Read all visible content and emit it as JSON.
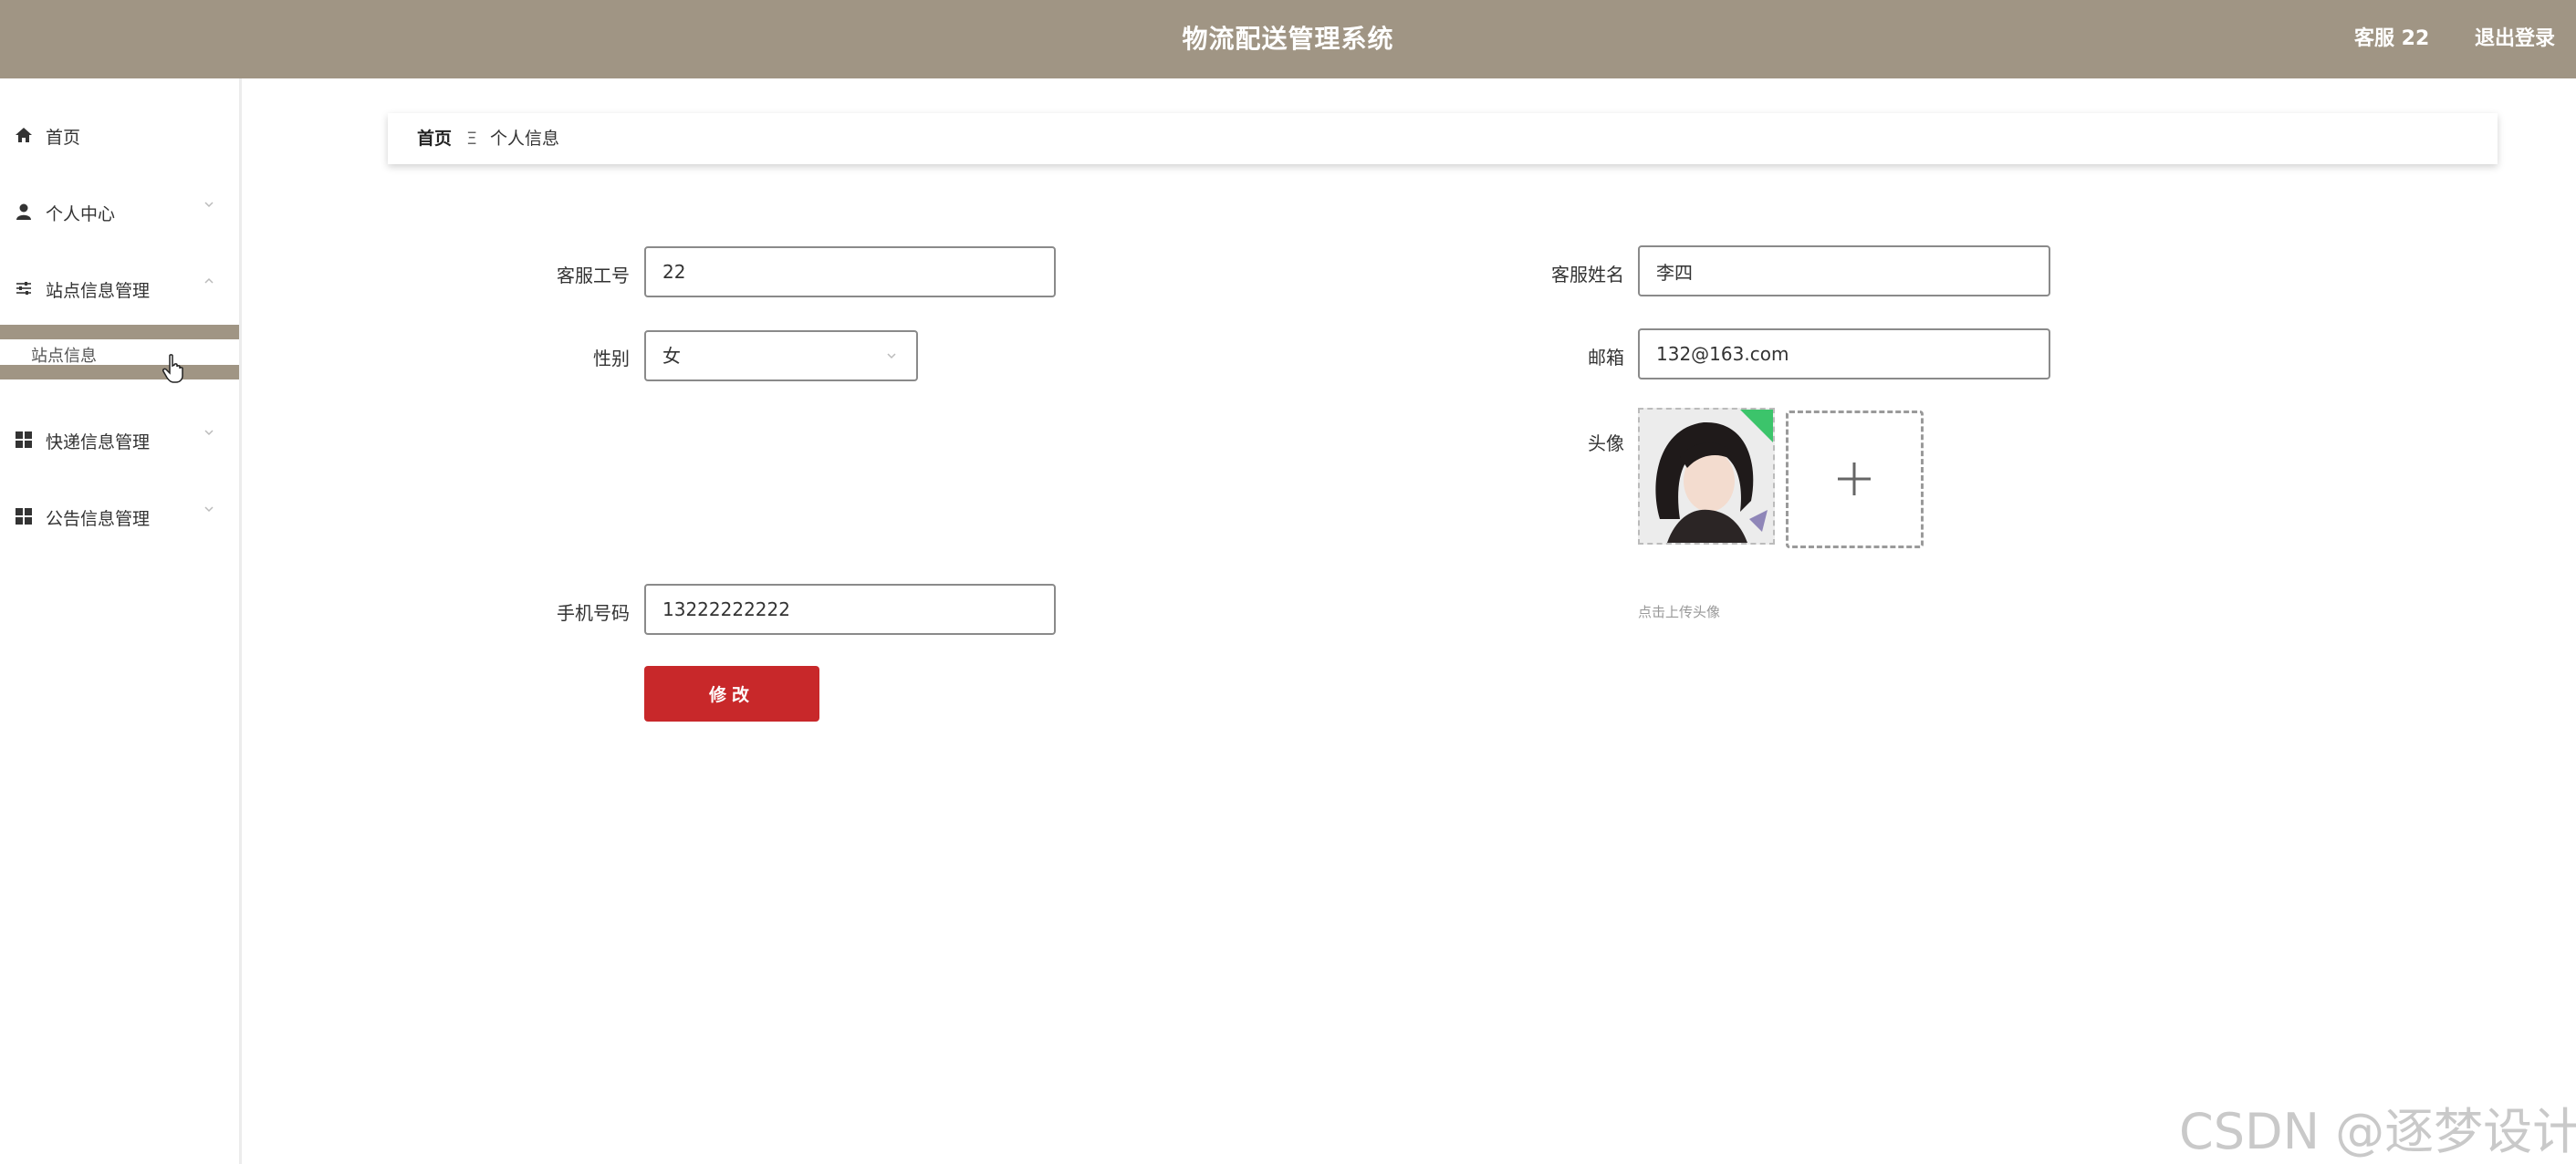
{
  "header": {
    "title": "物流配送管理系统",
    "user": "客服 22",
    "logout": "退出登录"
  },
  "sidebar": {
    "items": [
      {
        "label": "首页",
        "icon": "home-icon"
      },
      {
        "label": "个人中心",
        "icon": "user-icon"
      },
      {
        "label": "站点信息管理",
        "icon": "sliders-icon"
      },
      {
        "label": "快递信息管理",
        "icon": "grid-icon"
      },
      {
        "label": "公告信息管理",
        "icon": "grid-icon"
      }
    ],
    "active_sub": "站点信息"
  },
  "breadcrumb": {
    "home": "首页",
    "separator": "Ξ",
    "current": "个人信息"
  },
  "form": {
    "staff_no_label": "客服工号",
    "staff_no_value": "22",
    "gender_label": "性别",
    "gender_value": "女",
    "phone_label": "手机号码",
    "phone_value": "13222222222",
    "name_label": "客服姓名",
    "name_value": "李四",
    "email_label": "邮箱",
    "email_value": "132@163.com",
    "avatar_label": "头像",
    "upload_hint": "点击上传头像",
    "submit_label": "修改"
  },
  "watermark": "CSDN @逐梦设计",
  "colors": {
    "header_bg": "#a09584",
    "submit_bg": "#c8282a"
  }
}
